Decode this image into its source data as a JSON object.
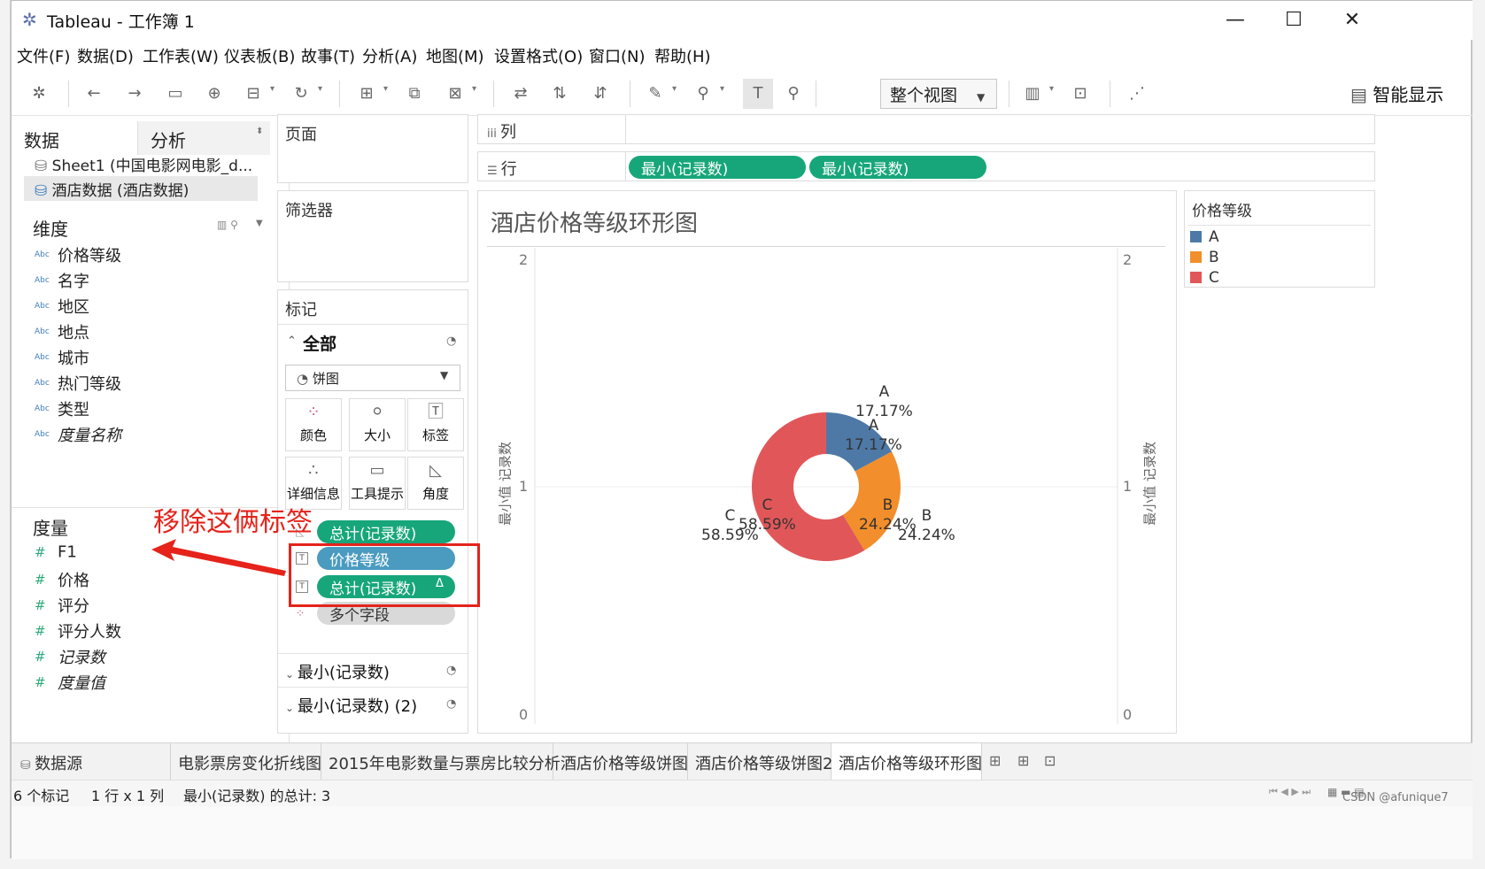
{
  "window": {
    "title": "Tableau - 工作簿 1"
  },
  "menu": [
    "文件(F)",
    "数据(D)",
    "工作表(W)",
    "仪表板(B)",
    "故事(T)",
    "分析(A)",
    "地图(M)",
    "设置格式(O)",
    "窗口(N)",
    "帮助(H)"
  ],
  "toolbar": {
    "fit_value": "整个视图",
    "show_me_label": "智能显示"
  },
  "data_pane": {
    "tabs": [
      "数据",
      "分析"
    ],
    "sources": [
      "Sheet1 (中国电影网电影_d...",
      "酒店数据 (酒店数据)"
    ],
    "dimensions_title": "维度",
    "dimensions": [
      "价格等级",
      "名字",
      "地区",
      "地点",
      "城市",
      "热门等级",
      "类型",
      "度量名称"
    ],
    "measures_title": "度量",
    "measures": [
      "F1",
      "价格",
      "评分",
      "评分人数",
      "记录数",
      "度量值"
    ],
    "type_abc": "Abc",
    "type_num": "#"
  },
  "shelves": {
    "pages": "页面",
    "filters": "筛选器",
    "columns": "列",
    "rows": "行",
    "row_pills": [
      "最小(记录数)",
      "最小(记录数)"
    ]
  },
  "marks": {
    "title": "标记",
    "all_label": "全部",
    "mark_type": "饼图",
    "buttons": [
      "颜色",
      "大小",
      "标签",
      "详细信息",
      "工具提示",
      "角度"
    ],
    "pills": [
      "总计(记录数)",
      "价格等级",
      "总计(记录数)",
      "多个字段"
    ],
    "delta": "Δ",
    "sub_cards": [
      "最小(记录数)",
      "最小(记录数) (2)"
    ]
  },
  "view": {
    "title": "酒店价格等级环形图",
    "axis_title": "最小值 记录数",
    "axis_ticks": [
      "2",
      "1",
      "0"
    ]
  },
  "chart_data": {
    "type": "pie",
    "title": "酒店价格等级环形图",
    "donut": true,
    "ylabel": "最小值 记录数",
    "ylim": [
      0,
      2
    ],
    "categories": [
      "A",
      "B",
      "C"
    ],
    "values": [
      17.17,
      24.24,
      58.59
    ],
    "value_labels": [
      "17.17%",
      "24.24%",
      "58.59%"
    ],
    "colors": [
      "#4e79a7",
      "#f28e2b",
      "#e15759"
    ],
    "legend_title": "价格等级",
    "legend_position": "top-right"
  },
  "annotation": {
    "text": "移除这俩标签",
    "color": "#e5231b"
  },
  "tabs": {
    "datasource": "数据源",
    "sheets": [
      "电影票房变化折线图",
      "2015年电影数量与票房比较分析",
      "酒店价格等级饼图",
      "酒店价格等级饼图2",
      "酒店价格等级环形图"
    ],
    "active": "酒店价格等级环形图"
  },
  "status": {
    "marks": "6 个标记",
    "grid": "1 行 x 1 列",
    "summary": "最小(记录数) 的总计: 3"
  },
  "watermark": "CSDN @afunique7"
}
